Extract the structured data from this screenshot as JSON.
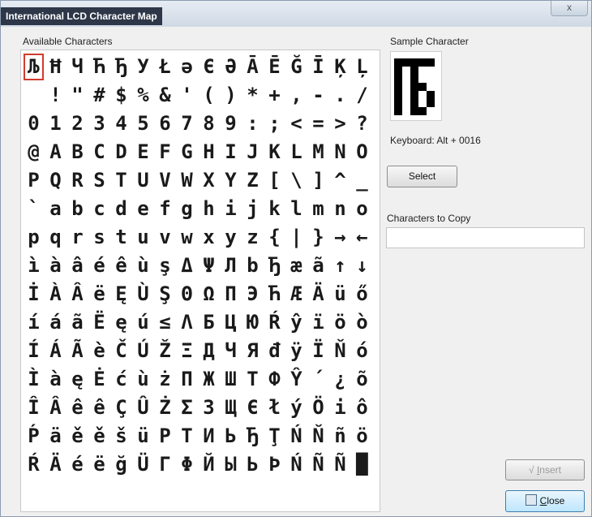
{
  "window": {
    "title": "International LCD Character Map",
    "close_glyph": "x"
  },
  "labels": {
    "available": "Available Characters",
    "sample": "Sample Character",
    "keyboard": "Keyboard: Alt + 0016",
    "to_copy": "Characters to Copy"
  },
  "buttons": {
    "select": "Select",
    "insert_icon": "√",
    "insert_hot": "I",
    "insert_rest": "nsert",
    "close_hot": "C",
    "close_rest": "lose"
  },
  "copy_field": {
    "value": ""
  },
  "grid": {
    "rows": [
      [
        "Љ",
        "Ħ",
        "Ч",
        "Ћ",
        "Ђ",
        "У",
        "Ł",
        "ə",
        "Є",
        "Ә",
        "Ā",
        "Ē",
        "Ğ",
        "Ī",
        "Ķ",
        "Ļ"
      ],
      [
        " ",
        "!",
        "\"",
        "#",
        "$",
        "%",
        "&",
        "'",
        "(",
        ")",
        "*",
        "+",
        ",",
        "-",
        ".",
        "/"
      ],
      [
        "0",
        "1",
        "2",
        "3",
        "4",
        "5",
        "6",
        "7",
        "8",
        "9",
        ":",
        ";",
        "<",
        "=",
        ">",
        "?"
      ],
      [
        "@",
        "A",
        "B",
        "C",
        "D",
        "E",
        "F",
        "G",
        "H",
        "I",
        "J",
        "K",
        "L",
        "M",
        "N",
        "O"
      ],
      [
        "P",
        "Q",
        "R",
        "S",
        "T",
        "U",
        "V",
        "W",
        "X",
        "Y",
        "Z",
        "[",
        "\\",
        "]",
        "^",
        "_"
      ],
      [
        "`",
        "a",
        "b",
        "c",
        "d",
        "e",
        "f",
        "g",
        "h",
        "i",
        "j",
        "k",
        "l",
        "m",
        "n",
        "o"
      ],
      [
        "p",
        "q",
        "r",
        "s",
        "t",
        "u",
        "v",
        "w",
        "x",
        "y",
        "z",
        "{",
        "|",
        "}",
        "→",
        "←"
      ],
      [
        "ì",
        "à",
        "â",
        "é",
        "ê",
        "ù",
        "ş",
        "Δ",
        "Ψ",
        "Л",
        "b",
        "Ђ",
        "æ",
        "ã",
        "↑",
        "↓"
      ],
      [
        "İ",
        "À",
        "Â",
        "ë",
        "Ę",
        "Ù",
        "Ş",
        "Θ",
        "Ω",
        "Π",
        "Э",
        "Ћ",
        "Æ",
        "Ä",
        "ü",
        "ő"
      ],
      [
        "í",
        "á",
        "ã",
        "Ë",
        "ę",
        "ú",
        "≤",
        "Λ",
        "Б",
        "Ц",
        "Ю",
        "Ŕ",
        "ŷ",
        "ï",
        "ö",
        "ò"
      ],
      [
        "Í",
        "Á",
        "Ã",
        "è",
        "Č",
        "Ú",
        "Ž",
        "Ξ",
        "Д",
        "Ч",
        "Я",
        "đ",
        "ÿ",
        "Ï",
        "Ň",
        "ó"
      ],
      [
        "Ì",
        "à",
        "ę",
        "Ė",
        "ć",
        "ù",
        "ż",
        "Π",
        "Ж",
        "Ш",
        "Т",
        "Ф",
        "Ŷ",
        "´",
        "¿",
        "õ"
      ],
      [
        "Î",
        "Â",
        "ê",
        "ê",
        "Ç",
        "Û",
        "Ż",
        "Σ",
        "З",
        "Щ",
        "Є",
        "ł",
        "ý",
        "Ö",
        "i",
        "ô"
      ],
      [
        "Ṕ",
        "ä",
        "ě",
        "ě",
        "š",
        "ü",
        "Ρ",
        "Τ",
        "И",
        "Ь",
        "Ђ",
        "Ţ",
        "Ń",
        "Ň",
        "ñ",
        "ö"
      ],
      [
        "Ŕ",
        "Ä",
        "é",
        "ë",
        "ğ",
        "Ü",
        "Γ",
        "Φ",
        "Й",
        "Ы",
        "Ь",
        "Þ",
        "Ń",
        "Ñ",
        "Ñ",
        "█"
      ]
    ]
  },
  "sample_glyph": {
    "name": "Lje",
    "on_color": "#000000",
    "rows": [
      "11111",
      "10100",
      "10100",
      "10110",
      "10101",
      "10101",
      "10110"
    ]
  },
  "colors": {
    "selection": "#d23b2e"
  }
}
